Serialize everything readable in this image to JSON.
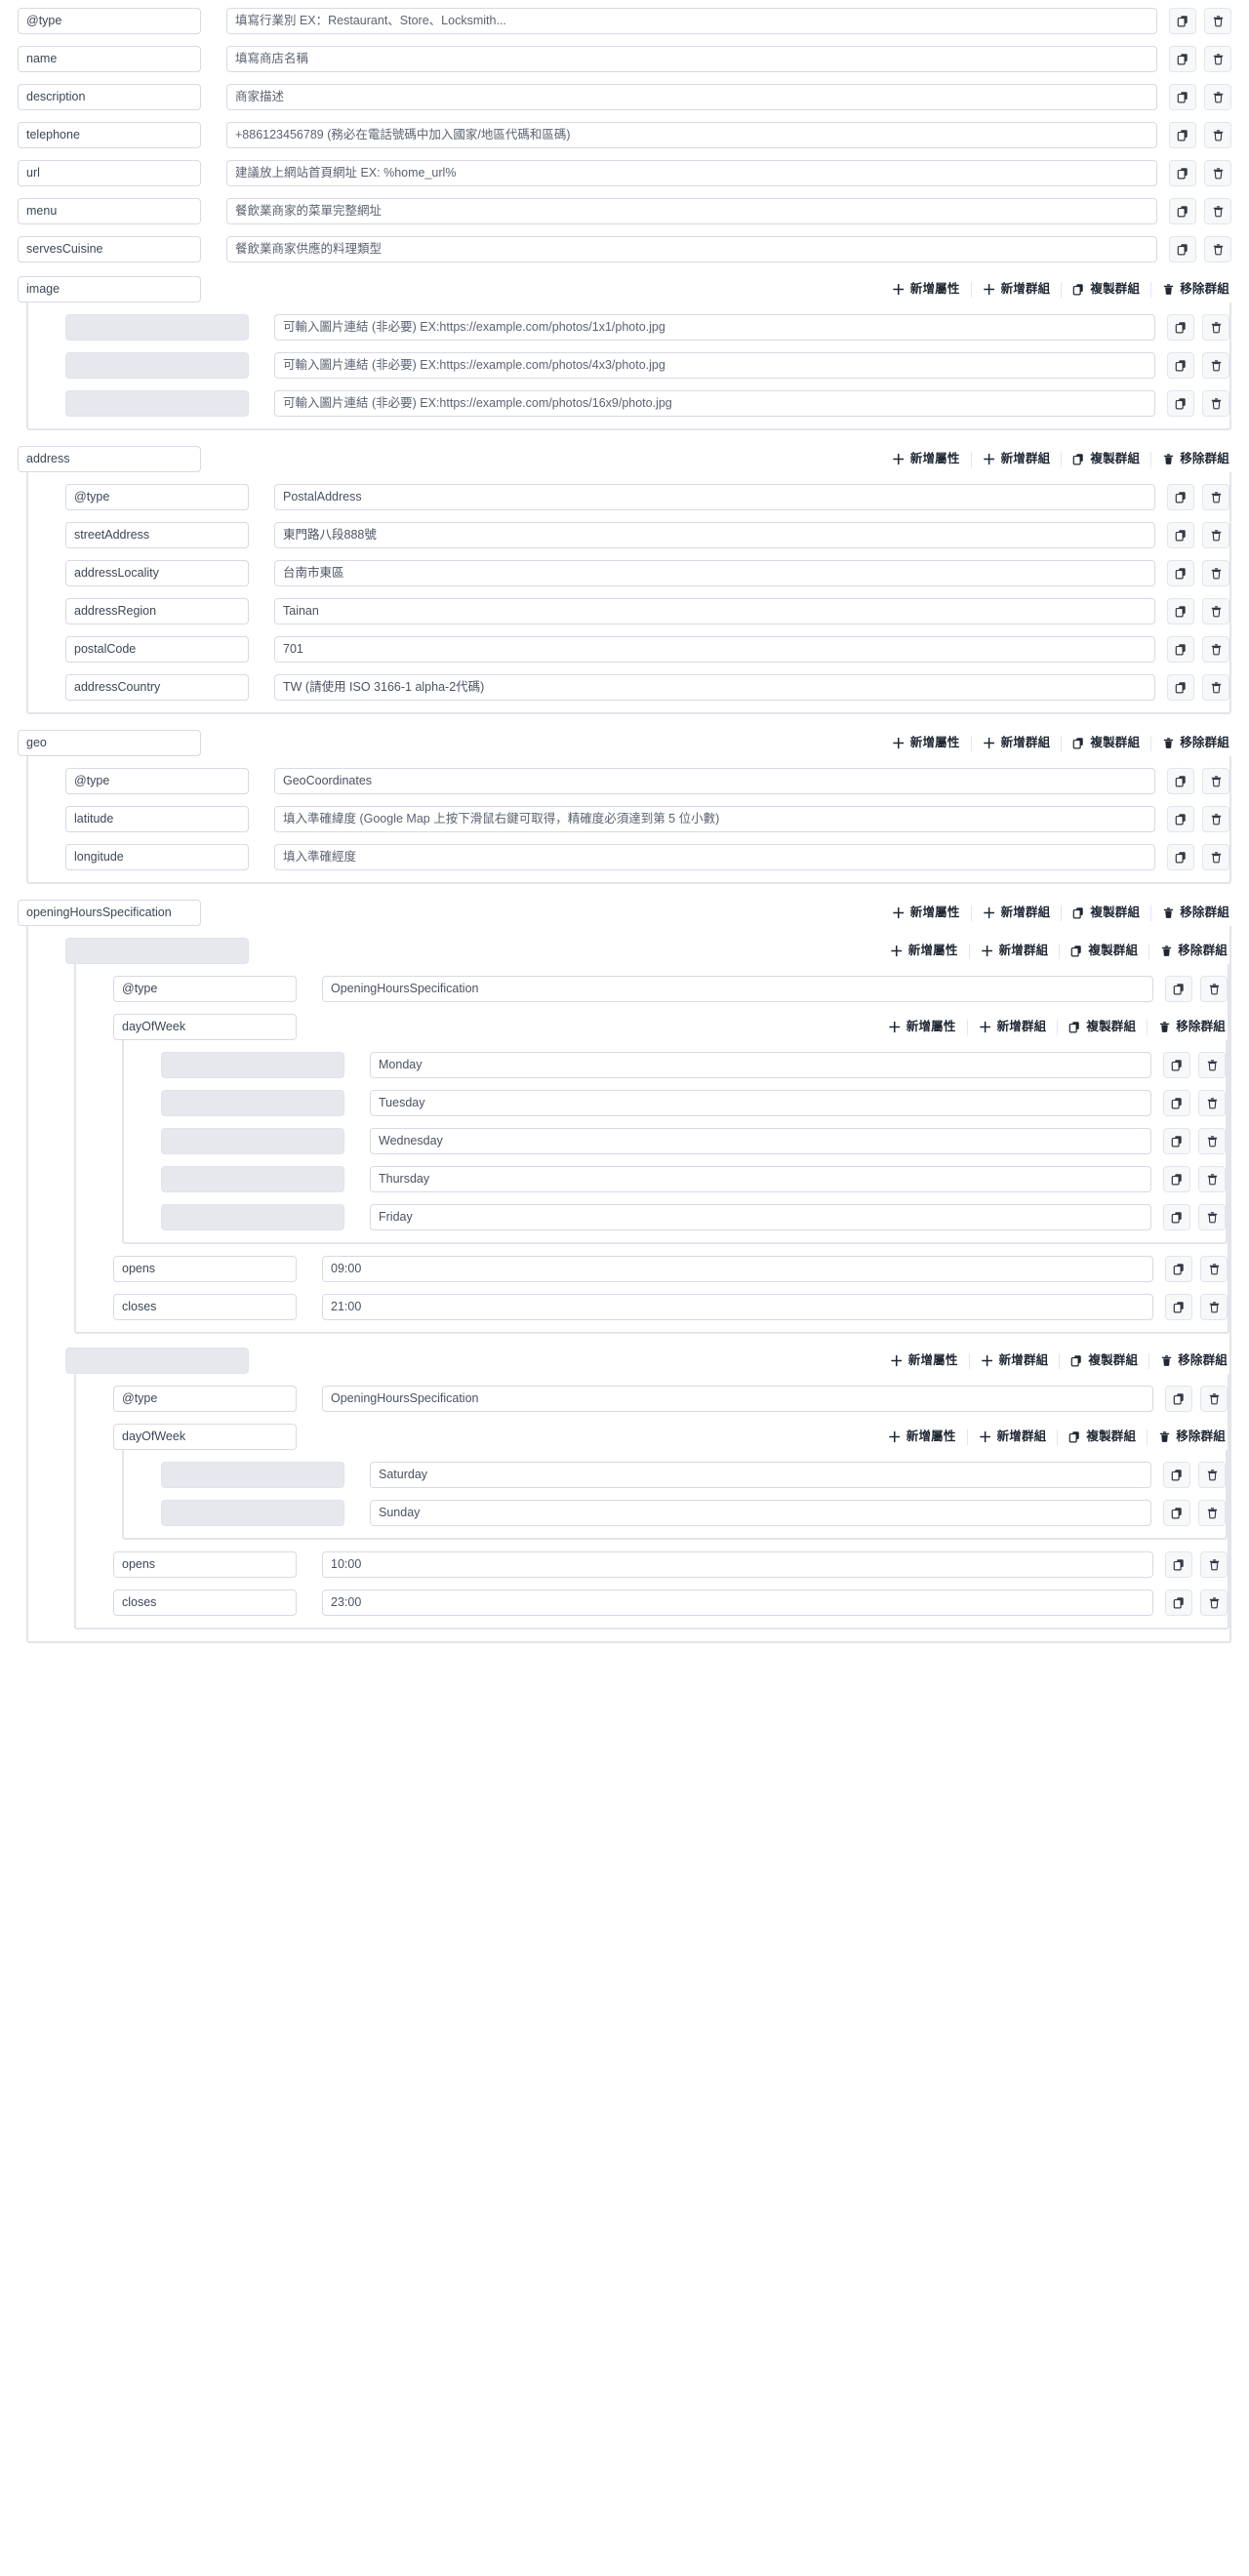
{
  "icons": {
    "copy": "copy-icon",
    "trash": "trash-icon",
    "plus": "plus-icon"
  },
  "group_actions": {
    "add_attribute": "新增屬性",
    "add_group": "新增群組",
    "copy_group": "複製群組",
    "remove_group": "移除群組",
    "plus": "＋"
  },
  "fields": [
    {
      "key": "@type",
      "value": "填寫行業別 EX：Restaurant、Store、Locksmith..."
    },
    {
      "key": "name",
      "value": "填寫商店名稱"
    },
    {
      "key": "description",
      "value": "商家描述"
    },
    {
      "key": "telephone",
      "value": "+886123456789 (務必在電話號碼中加入國家/地區代碼和區碼)"
    },
    {
      "key": "url",
      "value": "建議放上網站首頁網址 EX: %home_url%"
    },
    {
      "key": "menu",
      "value": "餐飲業商家的菜單完整網址"
    },
    {
      "key": "servesCuisine",
      "value": "餐飲業商家供應的料理類型"
    }
  ],
  "image_group": {
    "key": "image",
    "items": [
      {
        "key": "",
        "value": "可輸入圖片連結 (非必要) EX:https://example.com/photos/1x1/photo.jpg"
      },
      {
        "key": "",
        "value": "可輸入圖片連結 (非必要) EX:https://example.com/photos/4x3/photo.jpg"
      },
      {
        "key": "",
        "value": "可輸入圖片連結 (非必要) EX:https://example.com/photos/16x9/photo.jpg"
      }
    ]
  },
  "address_group": {
    "key": "address",
    "items": [
      {
        "key": "@type",
        "value": "PostalAddress"
      },
      {
        "key": "streetAddress",
        "value": "東門路八段888號"
      },
      {
        "key": "addressLocality",
        "value": "台南市東區"
      },
      {
        "key": "addressRegion",
        "value": "Tainan"
      },
      {
        "key": "postalCode",
        "value": "701"
      },
      {
        "key": "addressCountry",
        "value": "TW (請使用 ISO 3166-1 alpha-2代碼)"
      }
    ]
  },
  "geo_group": {
    "key": "geo",
    "items": [
      {
        "key": "@type",
        "value": "GeoCoordinates"
      },
      {
        "key": "latitude",
        "value": "填入準確緯度 (Google Map 上按下滑鼠右鍵可取得，精確度必須達到第 5 位小數)"
      },
      {
        "key": "longitude",
        "value": "填入準確經度"
      }
    ]
  },
  "opening_hours_group": {
    "key": "openingHoursSpecification",
    "entries": [
      {
        "key": "",
        "type_row": {
          "key": "@type",
          "value": "OpeningHoursSpecification"
        },
        "day_of_week": {
          "key": "dayOfWeek",
          "days": [
            {
              "key": "",
              "value": "Monday"
            },
            {
              "key": "",
              "value": "Tuesday"
            },
            {
              "key": "",
              "value": "Wednesday"
            },
            {
              "key": "",
              "value": "Thursday"
            },
            {
              "key": "",
              "value": "Friday"
            }
          ]
        },
        "opens": {
          "key": "opens",
          "value": "09:00"
        },
        "closes": {
          "key": "closes",
          "value": "21:00"
        }
      },
      {
        "key": "",
        "type_row": {
          "key": "@type",
          "value": "OpeningHoursSpecification"
        },
        "day_of_week": {
          "key": "dayOfWeek",
          "days": [
            {
              "key": "",
              "value": "Saturday"
            },
            {
              "key": "",
              "value": "Sunday"
            }
          ]
        },
        "opens": {
          "key": "opens",
          "value": "10:00"
        },
        "closes": {
          "key": "closes",
          "value": "23:00"
        }
      }
    ]
  },
  "colors": {
    "border": "#d7dae3",
    "disabled_bg": "#e6e8ee",
    "tree_line": "#dde0e7",
    "text": "#2d3748",
    "icon_btn_bg": "#f7f8fa"
  }
}
